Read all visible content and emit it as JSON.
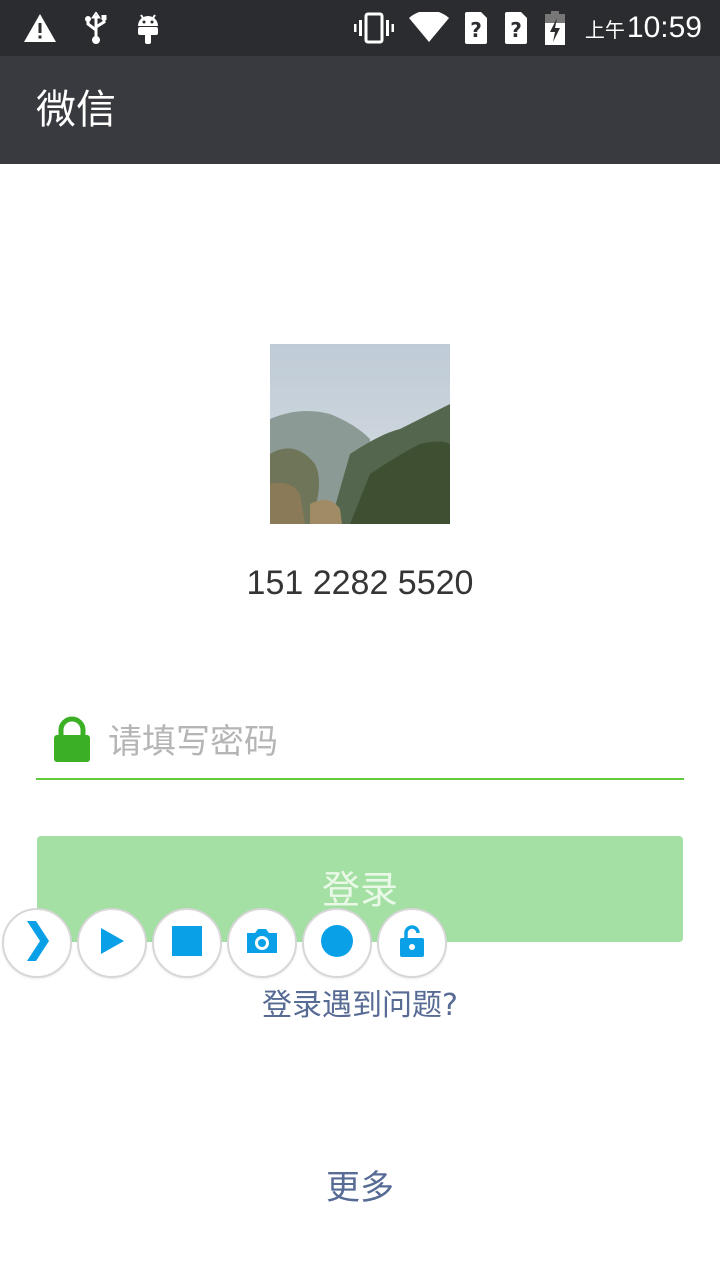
{
  "status_bar": {
    "ampm": "上午",
    "time": "10:59",
    "icons": [
      "warning-icon",
      "usb-icon",
      "android-debug-icon",
      "vibrate-icon",
      "wifi-icon",
      "sim-unknown-icon",
      "sim-unknown-icon",
      "battery-charging-icon"
    ]
  },
  "app_bar": {
    "title": "微信"
  },
  "account": {
    "phone": "151 2282 5520"
  },
  "password": {
    "placeholder": "请填写密码",
    "value": ""
  },
  "login_button": {
    "label": "登录"
  },
  "trouble_link": {
    "label": "登录遇到问题?"
  },
  "more_link": {
    "label": "更多"
  },
  "floating_toolbar": {
    "buttons": [
      "expand-icon",
      "play-icon",
      "stop-icon",
      "camera-icon",
      "record-icon",
      "unlock-icon"
    ]
  },
  "colors": {
    "status_bar": "#2b2c30",
    "app_bar": "#393a3f",
    "accent_green": "#46c11b",
    "button_disabled": "#a4e0a4",
    "link_blue": "#576b95",
    "toolbar_icon": "#0aa0e8"
  }
}
